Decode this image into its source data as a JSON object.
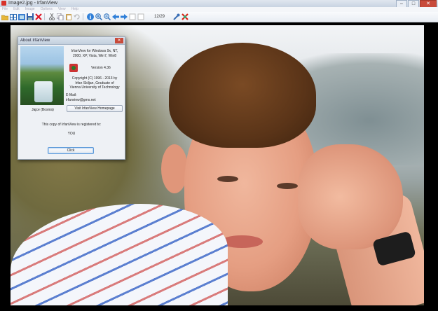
{
  "window": {
    "title": "Image2.jpg - IrfanView",
    "minimize": "–",
    "maximize": "□",
    "close": "✕"
  },
  "menu": [
    "File",
    "Edit",
    "Image",
    "Options",
    "View",
    "Help"
  ],
  "toolbar": {
    "counter": "12/29",
    "icons": [
      "open-icon",
      "thumbnails-icon",
      "slideshow-icon",
      "save-icon",
      "delete-icon",
      "cut-icon",
      "copy-icon",
      "paste-icon",
      "undo-icon",
      "info-icon",
      "zoom-in-icon",
      "zoom-out-icon",
      "prev-icon",
      "next-icon",
      "first-icon",
      "last-icon",
      "settings-icon",
      "exit-icon"
    ]
  },
  "about_dialog": {
    "title": "About  IrfanView",
    "close": "✕",
    "photo_caption": "Jajce (Bosnia)",
    "product_line1": "IrfanView for Windows 9x, NT,",
    "product_line2": "2000, XP, Vista, Win7, Win8",
    "version": "Version 4.36",
    "copyright_line1": "Copyright (C) 1996 - 2013 by",
    "copyright_line2": "Irfan Skiljan, Graduate of",
    "copyright_line3": "Vienna University of Technology",
    "email_label": "E-Mail:",
    "email": "irfanview@gmx.net",
    "homepage_button": "Visit IrfanView Homepage",
    "registered_text": "This copy of IrfanView is registered to:",
    "registered_to": "YOU",
    "ok_button": "Click"
  }
}
